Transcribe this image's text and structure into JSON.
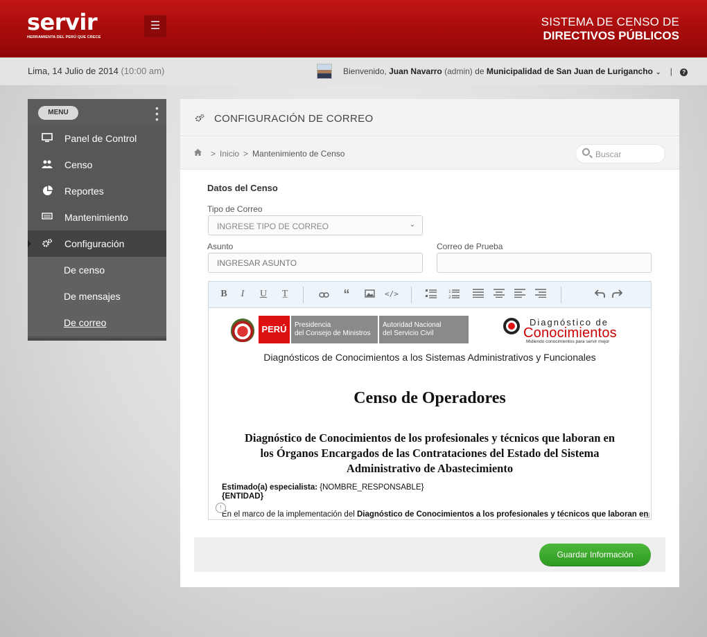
{
  "brand": {
    "logo_text": "servir",
    "logo_tagline": "HERRAMIENTA DEL PERÚ QUE CRECE",
    "system_title_line1": "SISTEMA DE CENSO  DE",
    "system_title_line2": "DIRECTIVOS PÚBLICOS"
  },
  "header": {
    "menu_icon": "hamburger-icon",
    "date": "Lima, 14 Julio de 2014",
    "time": "(10:00 am)",
    "welcome_prefix": "Bienvenido,",
    "user_name": "Juan Navarro",
    "user_role": "(admin)",
    "of": "de",
    "organization": "Municipalidad de San Juan de Lurigancho"
  },
  "sidebar": {
    "menu_label": "MENU",
    "items": [
      {
        "label": "Panel de Control",
        "icon": "monitor-icon"
      },
      {
        "label": "Censo",
        "icon": "users-icon"
      },
      {
        "label": "Reportes",
        "icon": "pie-chart-icon"
      },
      {
        "label": "Mantenimiento",
        "icon": "keyboard-icon"
      },
      {
        "label": "Configuración",
        "icon": "gears-icon"
      }
    ],
    "subitems": [
      {
        "label": "De censo"
      },
      {
        "label": "De mensajes"
      },
      {
        "label": "De correo"
      }
    ]
  },
  "panel": {
    "title": "CONFIGURACIÓN DE CORREO",
    "breadcrumb": {
      "home": "Inicio",
      "current": "Mantenimiento de Censo"
    },
    "search_placeholder": "Buscar"
  },
  "form": {
    "section_title": "Datos del Censo",
    "tipo_label": "Tipo de Correo",
    "tipo_value": "INGRESE TIPO DE CORREO",
    "asunto_label": "Asunto",
    "asunto_placeholder": "INGRESAR ASUNTO",
    "prueba_label": "Correo de Prueba",
    "prueba_placeholder": ""
  },
  "editor": {
    "toolbar_icons": [
      "bold-icon",
      "italic-icon",
      "underline-icon",
      "strikethrough-icon",
      "link-icon",
      "quote-icon",
      "image-icon",
      "code-icon",
      "bulleted-list-icon",
      "numbered-list-icon",
      "justify-icon",
      "align-center-icon",
      "align-left-icon",
      "align-right-icon",
      "undo-icon",
      "redo-icon"
    ],
    "logos": {
      "peru": "PERÚ",
      "presidencia": "Presidencia\ndel Consejo de Ministros",
      "autoridad": "Autoridad Nacional\ndel Servicio Civil",
      "diag_line1": "Diagnóstico de",
      "diag_line2": "Conocimientos",
      "diag_line3": "Midiendo conocimientos para servir mejor"
    },
    "subtitle": "Diagnósticos de Conocimientos a los Sistemas Administrativos y Funcionales",
    "title": "Censo de Operadores",
    "heading_line1": "Diagnóstico de Conocimientos de los profesionales y técnicos que laboran en",
    "heading_line2": "los Órganos Encargados de las Contrataciones del Estado del Sistema",
    "heading_line3": "Administrativo de Abastecimiento",
    "greeting_label": "Estimado(a) especialista:",
    "greeting_var": "{NOMBRE_RESPONSABLE}",
    "entity_var": "{ENTIDAD}",
    "body_start": "En el marco de la implementación del ",
    "body_bold": "Diagnóstico de Conocimientos a los profesionales y técnicos que laboran en"
  },
  "actions": {
    "save_label": "Guardar Información"
  },
  "colors": {
    "brand_red": "#b00f0f",
    "save_green": "#3aa82c"
  }
}
